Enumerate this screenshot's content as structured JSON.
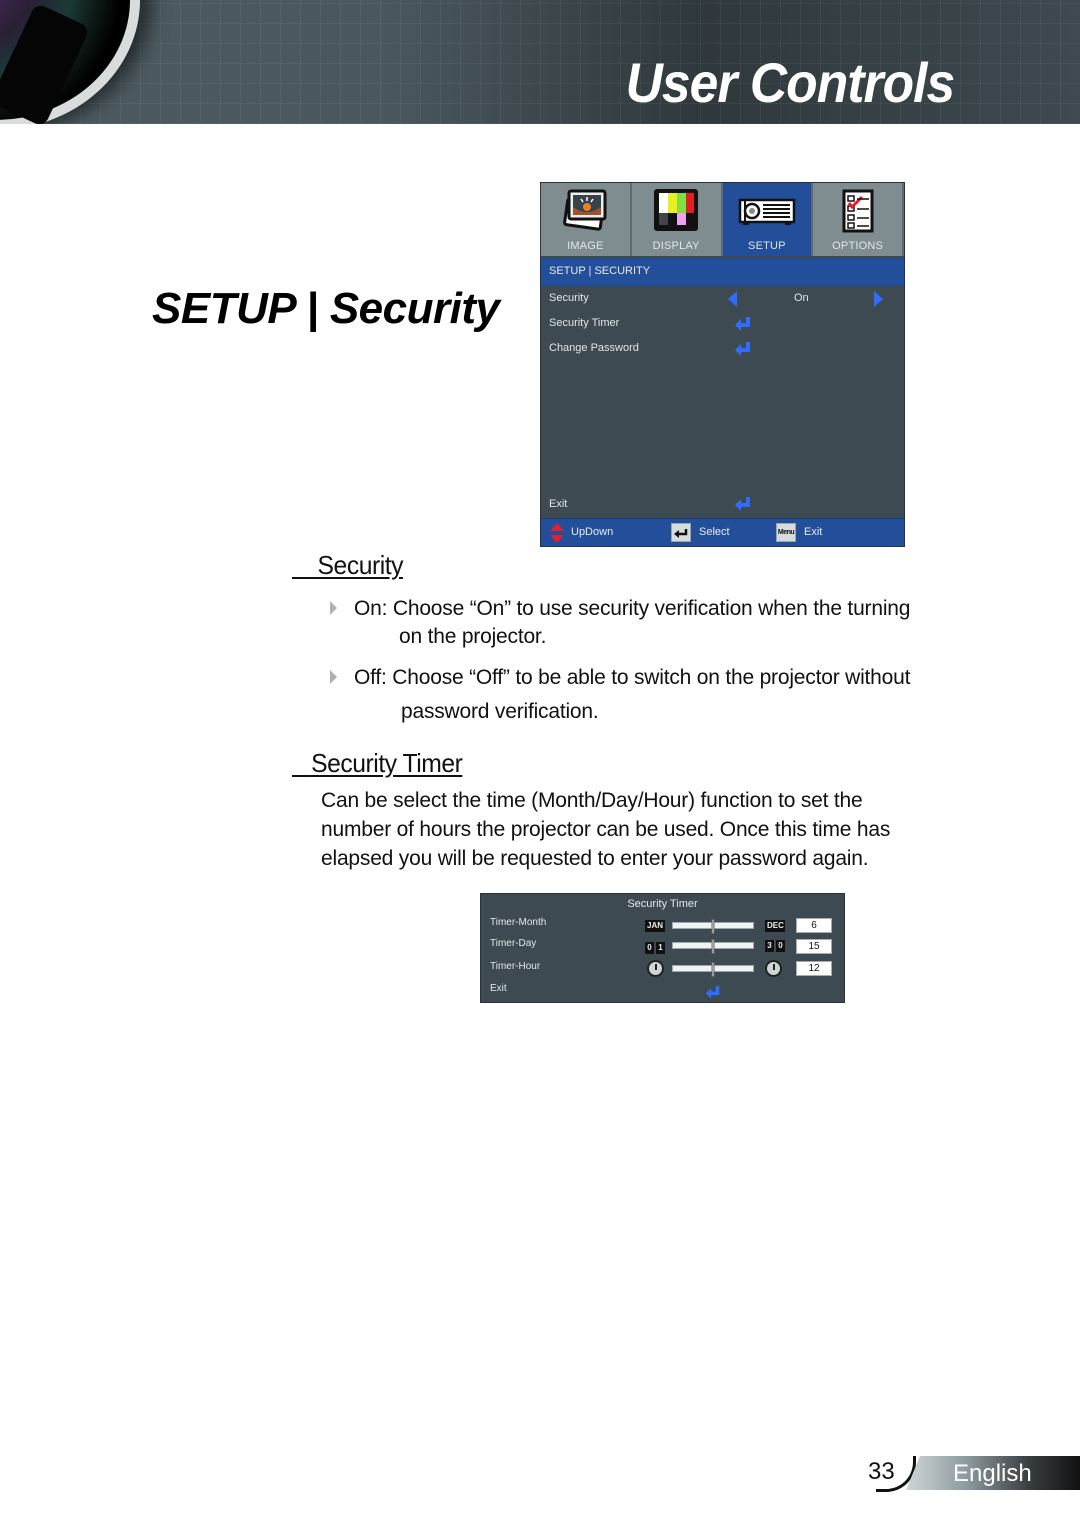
{
  "header": {
    "title": "User Controls"
  },
  "section_title": "SETUP | Security",
  "osd_menu": {
    "tabs": [
      {
        "label": "IMAGE",
        "icon": "image-icon",
        "active": false
      },
      {
        "label": "DISPLAY",
        "icon": "display-test-pattern-icon",
        "active": false
      },
      {
        "label": "SETUP",
        "icon": "projector-icon",
        "active": true
      },
      {
        "label": "OPTIONS",
        "icon": "checklist-icon",
        "active": false
      }
    ],
    "breadcrumb": "SETUP | SECURITY",
    "items": [
      {
        "label": "Security",
        "control": "selector",
        "value": "On"
      },
      {
        "label": "Security Timer",
        "control": "enter"
      },
      {
        "label": "Change Password",
        "control": "enter"
      }
    ],
    "exit_label": "Exit",
    "footer": {
      "updown_label": "UpDown",
      "select_label": "Select",
      "menu_key_label": "Menu",
      "exit_label": "Exit"
    },
    "accent_color": "#234f9a",
    "arrow_color": "#2f6cff"
  },
  "security_section": {
    "heading": "Security",
    "bullets": [
      {
        "line1": "On: Choose “On” to use security verification when the turning",
        "line2": "on the projector."
      },
      {
        "line1": "Off: Choose “Off” to be able to switch on the projector without",
        "line2": "password verification."
      }
    ]
  },
  "timer_section": {
    "heading": "Security Timer",
    "lines": [
      "Can be select the time (Month/Day/Hour) function to set the",
      "number of hours the projector can be used. Once this time has",
      "elapsed you will be requested to enter your password again."
    ]
  },
  "timer_panel": {
    "title": "Security Timer",
    "rows": [
      {
        "label": "Timer-Month",
        "min_label": "JAN",
        "max_label": "DEC",
        "value": "6",
        "position": 0.5
      },
      {
        "label": "Timer-Day",
        "min_label": "0 1",
        "max_label": "3 0",
        "value": "15",
        "position": 0.5
      },
      {
        "label": "Timer-Hour",
        "min_label": "clock",
        "max_label": "clock",
        "value": "12",
        "position": 0.5
      }
    ],
    "exit_label": "Exit"
  },
  "footer": {
    "page_number": "33",
    "language": "English"
  }
}
